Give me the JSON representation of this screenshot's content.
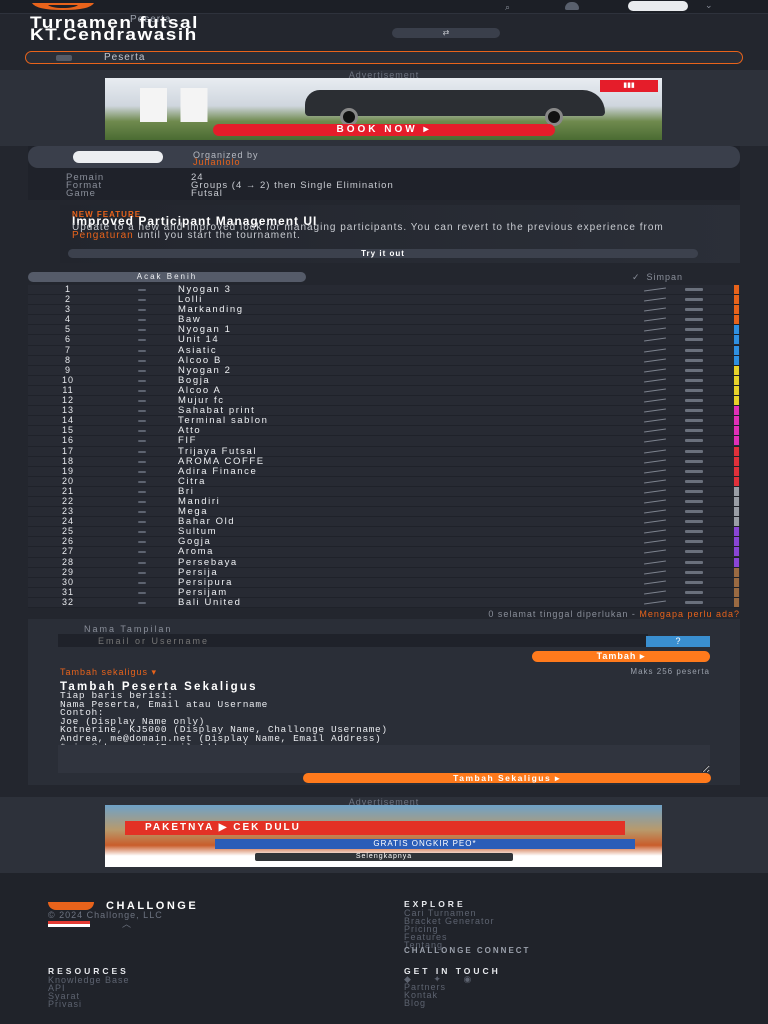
{
  "nav": {
    "search_icon": "search-icon",
    "chevron": "⌄"
  },
  "header": {
    "tab_label": "Peserta",
    "title_line1": "Turnamen futsal",
    "title_line2": "KT.Cendrawasih",
    "share_icon": "⇄",
    "subnav_label": "Peserta"
  },
  "ads": {
    "label_top": "Advertisement",
    "ad1_cta": "BOOK NOW  ▸",
    "label_bottom": "Advertisement",
    "ad2_banner": "PAKETNYA ▶ CEK DULU",
    "ad2_sub": "GRATIS ONGKIR PEO*",
    "ad2_more": "Selengkapnya"
  },
  "organizer": {
    "label": "Organized by",
    "name": "Julianlolo",
    "meta": [
      {
        "key": "Pemain",
        "value": "24"
      },
      {
        "key": "Format",
        "value": "Groups (4 → 2) then Single Elimination"
      },
      {
        "key": "Game",
        "value": "Futsal"
      }
    ]
  },
  "feature": {
    "badge": "NEW FEATURE",
    "title": "Improved Participant Management UI",
    "text_a": "Update to a new and improved look for managing participants. You can revert to the previous experience from ",
    "link": "Pengaturan",
    "text_b": " until you start the tournament.",
    "cta": "Try it out"
  },
  "seeding": {
    "shuffle_label": "Acak Benih",
    "save_check": "✓",
    "save_label": "Simpan"
  },
  "participants": [
    {
      "seed": "1",
      "name": "Nyogan 3",
      "color": "#e8631b"
    },
    {
      "seed": "2",
      "name": "Lolli",
      "color": "#e8631b"
    },
    {
      "seed": "3",
      "name": "Markanding",
      "color": "#e8631b"
    },
    {
      "seed": "4",
      "name": "Baw",
      "color": "#e8631b"
    },
    {
      "seed": "5",
      "name": "Nyogan 1",
      "color": "#2f8fe0"
    },
    {
      "seed": "6",
      "name": "Unit 14",
      "color": "#2f8fe0"
    },
    {
      "seed": "7",
      "name": "Asiatic",
      "color": "#2f8fe0"
    },
    {
      "seed": "8",
      "name": "Alcoo B",
      "color": "#2f8fe0"
    },
    {
      "seed": "9",
      "name": "Nyogan 2",
      "color": "#e8d22a"
    },
    {
      "seed": "10",
      "name": "Bogja",
      "color": "#e8d22a"
    },
    {
      "seed": "11",
      "name": "Alcoo A",
      "color": "#e8d22a"
    },
    {
      "seed": "12",
      "name": "Mujur fc",
      "color": "#e8d22a"
    },
    {
      "seed": "13",
      "name": "Sahabat print",
      "color": "#e02fb8"
    },
    {
      "seed": "14",
      "name": "Terminal sablon",
      "color": "#e02fb8"
    },
    {
      "seed": "15",
      "name": "Atto",
      "color": "#e02fb8"
    },
    {
      "seed": "16",
      "name": "FIF",
      "color": "#e02fb8"
    },
    {
      "seed": "17",
      "name": "Trijaya Futsal",
      "color": "#e0303a"
    },
    {
      "seed": "18",
      "name": "AROMA COFFE",
      "color": "#e0303a"
    },
    {
      "seed": "19",
      "name": "Adira Finance",
      "color": "#e0303a"
    },
    {
      "seed": "20",
      "name": "Citra",
      "color": "#e0303a"
    },
    {
      "seed": "21",
      "name": "Bri",
      "color": "#9a9ea6"
    },
    {
      "seed": "22",
      "name": "Mandiri",
      "color": "#9a9ea6"
    },
    {
      "seed": "23",
      "name": "Mega",
      "color": "#9a9ea6"
    },
    {
      "seed": "24",
      "name": "Bahar Old",
      "color": "#9a9ea6"
    },
    {
      "seed": "25",
      "name": "Sultum",
      "color": "#8a45d6"
    },
    {
      "seed": "26",
      "name": "Gogja",
      "color": "#8a45d6"
    },
    {
      "seed": "27",
      "name": "Aroma",
      "color": "#8a45d6"
    },
    {
      "seed": "28",
      "name": "Persebaya",
      "color": "#8a45d6"
    },
    {
      "seed": "29",
      "name": "Persija",
      "color": "#9a6a42"
    },
    {
      "seed": "30",
      "name": "Persipura",
      "color": "#9a6a42"
    },
    {
      "seed": "31",
      "name": "Persijam",
      "color": "#9a6a42"
    },
    {
      "seed": "32",
      "name": "Bali United",
      "color": "#9a6a42"
    }
  ],
  "add": {
    "notice_a": "0 selamat tinggal diperlukan - ",
    "notice_link": "Mengapa perlu ada?",
    "display_label": "Nama Tampilan",
    "email_placeholder": "Email or Username",
    "question": "?",
    "add_button": "Tambah ▸",
    "bulk_link": "Tambah sekaligus ▾",
    "max": "Maks 256 peserta",
    "bulk_title": "Tambah Peserta Sekaligus",
    "bulk_instructions": "Tiap baris berisi:\nNama Peserta, Email atau Username\nContoh:\nJoe (Display Name only)\nKotnerine, KJ5000 (Display Name, Challonge Username)\nAndrea, me@domain.net (Display Name, Email Address)\n* joe@nbro.net (Email Address)",
    "bulk_button": "Tambah Sekaligus ▸"
  },
  "footer": {
    "brand": "CHALLONGE",
    "copyright": "© 2024 Challonge, LLC",
    "explore_head": "EXPLORE",
    "explore_links": [
      "Cari Turnamen",
      "Bracket Generator",
      "Pricing",
      "Features",
      "Tentang"
    ],
    "connect_badge": "CHALLONGE CONNECT",
    "resources_head": "RESOURCES",
    "resources_links": [
      "Knowledge Base",
      "API",
      "Syarat",
      "Privasi"
    ],
    "touch_head": "GET IN TOUCH",
    "touch_links": [
      "Partners",
      "Kontak",
      "Blog"
    ],
    "social": "◆ ✦ ◉"
  }
}
